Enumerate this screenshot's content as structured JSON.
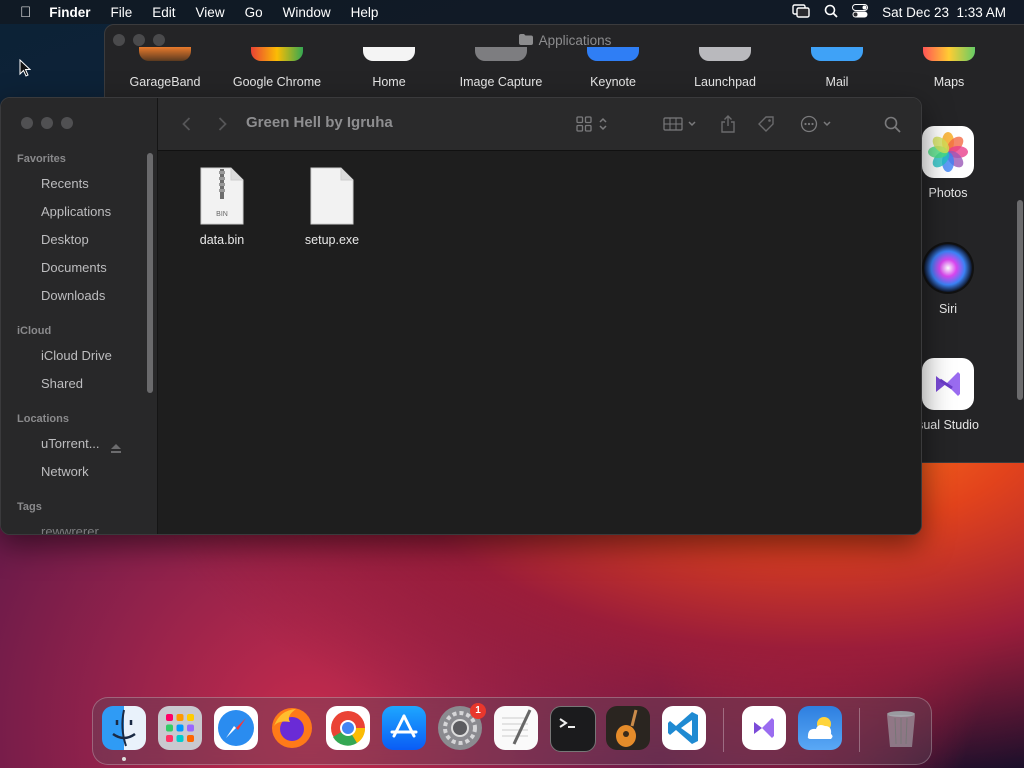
{
  "menubar": {
    "app_name": "Finder",
    "menus": [
      "File",
      "Edit",
      "View",
      "Go",
      "Window",
      "Help"
    ],
    "datetime": "Sat Dec 23  1:33 AM"
  },
  "applications_window": {
    "title": "Applications",
    "top_row_apps": [
      "GarageBand",
      "Google Chrome",
      "Home",
      "Image Capture",
      "Keynote",
      "Launchpad",
      "Mail",
      "Maps"
    ],
    "side_apps": [
      "Photos",
      "Siri",
      "sual Studio"
    ]
  },
  "finder": {
    "title": "Green Hell by Igruha",
    "sidebar": {
      "favorites_label": "Favorites",
      "favorites": [
        "Recents",
        "Applications",
        "Desktop",
        "Documents",
        "Downloads"
      ],
      "icloud_label": "iCloud",
      "icloud": [
        "iCloud Drive",
        "Shared"
      ],
      "locations_label": "Locations",
      "locations": [
        "uTorrent...",
        "Network"
      ],
      "tags_label": "Tags",
      "tags": [
        "rewwrerer"
      ]
    },
    "files": [
      {
        "name": "data.bin",
        "badge": "BIN"
      },
      {
        "name": "setup.exe",
        "badge": ""
      }
    ]
  },
  "dock": {
    "apps": [
      "Finder",
      "Launchpad",
      "Safari",
      "Firefox",
      "Google Chrome",
      "App Store",
      "System Settings",
      "TextEdit",
      "Terminal",
      "GarageBand",
      "Visual Studio Code",
      "Visual Studio",
      "Weather",
      "Trash"
    ],
    "settings_badge": "1"
  },
  "colors": {
    "finder_bg": "#1e1e1e",
    "sidebar_bg": "#282829",
    "badge_red": "#e8372c"
  }
}
